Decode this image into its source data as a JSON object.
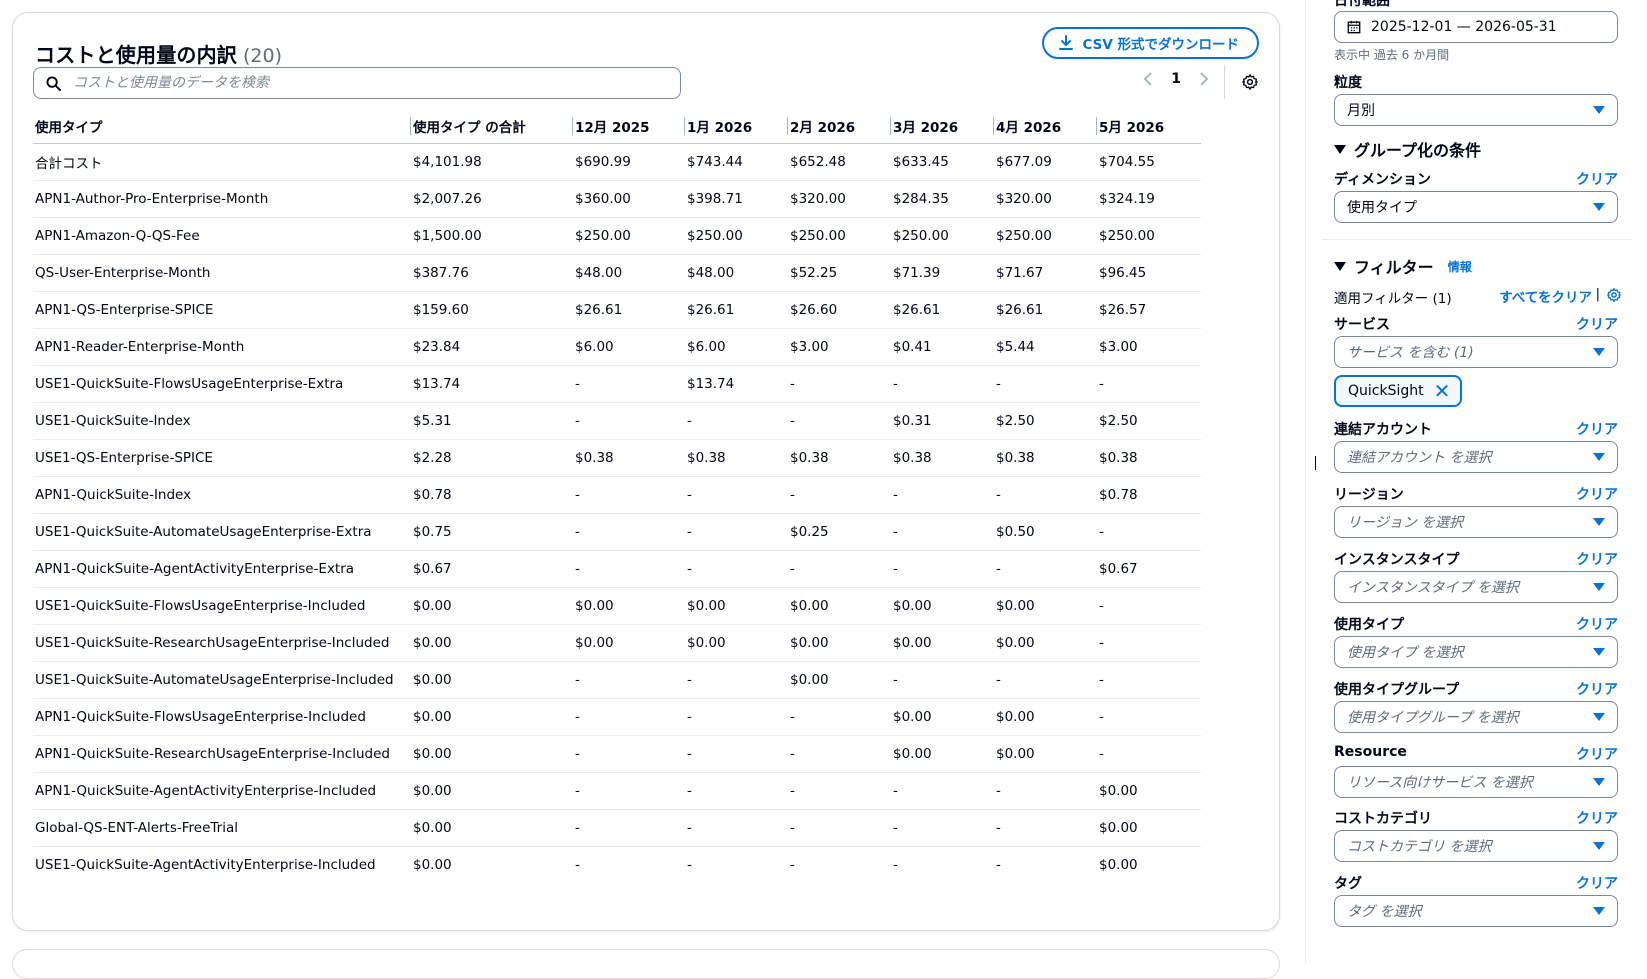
{
  "main": {
    "title": "コストと使用量の内訳",
    "count": "(20)",
    "csv_button": "CSV 形式でダウンロード",
    "search_placeholder": "コストと使用量のデータを検索",
    "page_number": "1",
    "columns": [
      "使用タイプ",
      "使用タイプ の合計",
      "12月 2025",
      "1月 2026",
      "2月 2026",
      "3月 2026",
      "4月 2026",
      "5月 2026"
    ],
    "rows": [
      [
        "合計コスト",
        "$4,101.98",
        "$690.99",
        "$743.44",
        "$652.48",
        "$633.45",
        "$677.09",
        "$704.55"
      ],
      [
        "APN1-Author-Pro-Enterprise-Month",
        "$2,007.26",
        "$360.00",
        "$398.71",
        "$320.00",
        "$284.35",
        "$320.00",
        "$324.19"
      ],
      [
        "APN1-Amazon-Q-QS-Fee",
        "$1,500.00",
        "$250.00",
        "$250.00",
        "$250.00",
        "$250.00",
        "$250.00",
        "$250.00"
      ],
      [
        "QS-User-Enterprise-Month",
        "$387.76",
        "$48.00",
        "$48.00",
        "$52.25",
        "$71.39",
        "$71.67",
        "$96.45"
      ],
      [
        "APN1-QS-Enterprise-SPICE",
        "$159.60",
        "$26.61",
        "$26.61",
        "$26.60",
        "$26.61",
        "$26.61",
        "$26.57"
      ],
      [
        "APN1-Reader-Enterprise-Month",
        "$23.84",
        "$6.00",
        "$6.00",
        "$3.00",
        "$0.41",
        "$5.44",
        "$3.00"
      ],
      [
        "USE1-QuickSuite-FlowsUsageEnterprise-Extra",
        "$13.74",
        "-",
        "$13.74",
        "-",
        "-",
        "-",
        "-"
      ],
      [
        "USE1-QuickSuite-Index",
        "$5.31",
        "-",
        "-",
        "-",
        "$0.31",
        "$2.50",
        "$2.50"
      ],
      [
        "USE1-QS-Enterprise-SPICE",
        "$2.28",
        "$0.38",
        "$0.38",
        "$0.38",
        "$0.38",
        "$0.38",
        "$0.38"
      ],
      [
        "APN1-QuickSuite-Index",
        "$0.78",
        "-",
        "-",
        "-",
        "-",
        "-",
        "$0.78"
      ],
      [
        "USE1-QuickSuite-AutomateUsageEnterprise-Extra",
        "$0.75",
        "-",
        "-",
        "$0.25",
        "-",
        "$0.50",
        "-"
      ],
      [
        "APN1-QuickSuite-AgentActivityEnterprise-Extra",
        "$0.67",
        "-",
        "-",
        "-",
        "-",
        "-",
        "$0.67"
      ],
      [
        "USE1-QuickSuite-FlowsUsageEnterprise-Included",
        "$0.00",
        "$0.00",
        "$0.00",
        "$0.00",
        "$0.00",
        "$0.00",
        "-"
      ],
      [
        "USE1-QuickSuite-ResearchUsageEnterprise-Included",
        "$0.00",
        "$0.00",
        "$0.00",
        "$0.00",
        "$0.00",
        "$0.00",
        "-"
      ],
      [
        "USE1-QuickSuite-AutomateUsageEnterprise-Included",
        "$0.00",
        "-",
        "-",
        "$0.00",
        "-",
        "-",
        "-"
      ],
      [
        "APN1-QuickSuite-FlowsUsageEnterprise-Included",
        "$0.00",
        "-",
        "-",
        "-",
        "$0.00",
        "$0.00",
        "-"
      ],
      [
        "APN1-QuickSuite-ResearchUsageEnterprise-Included",
        "$0.00",
        "-",
        "-",
        "-",
        "$0.00",
        "$0.00",
        "-"
      ],
      [
        "APN1-QuickSuite-AgentActivityEnterprise-Included",
        "$0.00",
        "-",
        "-",
        "-",
        "-",
        "-",
        "$0.00"
      ],
      [
        "Global-QS-ENT-Alerts-FreeTrial",
        "$0.00",
        "-",
        "-",
        "-",
        "-",
        "-",
        "$0.00"
      ],
      [
        "USE1-QuickSuite-AgentActivityEnterprise-Included",
        "$0.00",
        "-",
        "-",
        "-",
        "-",
        "-",
        "$0.00"
      ]
    ]
  },
  "sidebar": {
    "date_range_label": "日付範囲",
    "date_range_value": "2025-12-01 — 2026-05-31",
    "date_hint": "表示中 過去 6 か月間",
    "granularity_label": "粒度",
    "granularity_value": "月別",
    "group_by_heading": "グループ化の条件",
    "dimension_label": "ディメンション",
    "dimension_value": "使用タイプ",
    "clear_label": "クリア",
    "filters_heading": "フィルター",
    "info_label": "情報",
    "applied_filters": "適用フィルター (1)",
    "clear_all": "すべてをクリア",
    "service_label": "サービス",
    "service_value": "サービス を含む (1)",
    "service_token": "QuickSight",
    "linked_account_label": "連結アカウント",
    "linked_account_placeholder": "連結アカウント を選択",
    "region_label": "リージョン",
    "region_placeholder": "リージョン を選択",
    "instance_type_label": "インスタンスタイプ",
    "instance_type_placeholder": "インスタンスタイプ を選択",
    "usage_type_label": "使用タイプ",
    "usage_type_placeholder": "使用タイプ を選択",
    "usage_type_group_label": "使用タイプグループ",
    "usage_type_group_placeholder": "使用タイプグループ を選択",
    "resource_label": "Resource",
    "resource_placeholder": "リソース向けサービス を選択",
    "cost_category_label": "コストカテゴリ",
    "cost_category_placeholder": "コストカテゴリ を選択",
    "tag_label": "タグ",
    "tag_placeholder": "タグ を選択"
  },
  "colors": {
    "accent": "#0972d3",
    "border": "#7d8998",
    "text": "#000716",
    "muted": "#5f6b7a"
  }
}
